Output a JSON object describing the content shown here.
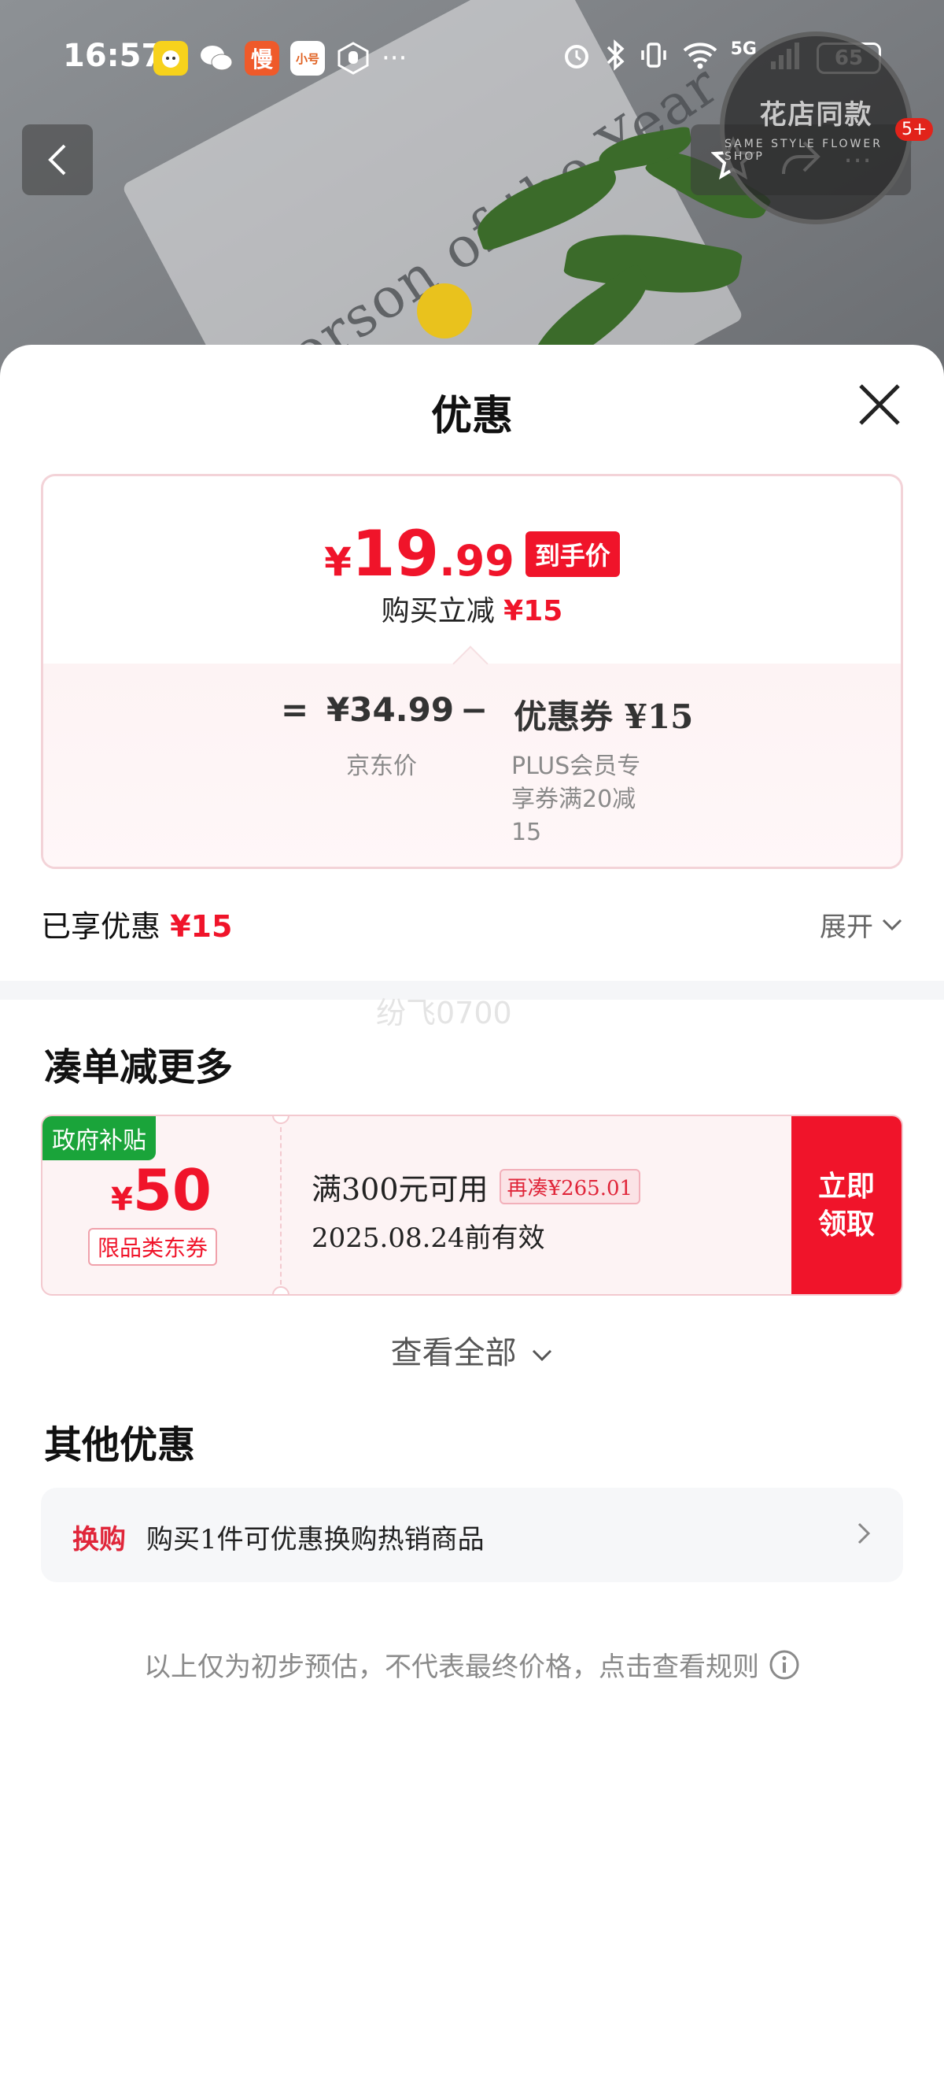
{
  "status_bar": {
    "time": "16:57",
    "network": "5G",
    "battery": "65",
    "app_icons": [
      "kids-app-icon",
      "wechat-icon",
      "man-app-icon",
      "xiaohao-app-icon",
      "hand-icon"
    ],
    "app_labels": {
      "man": "慢",
      "xiaohao": "小号"
    },
    "more": "···"
  },
  "product_bg": {
    "magazine_text": "Person of the Year",
    "stamp_title": "花店同款",
    "stamp_sub": "SAME STYLE FLOWER SHOP",
    "notification_badge": "5+"
  },
  "sheet": {
    "title": "优惠",
    "price_card": {
      "yen": "¥",
      "price_int": "19",
      "price_dec": ".99",
      "price_tag": "到手价",
      "instant_label": "购买立减",
      "instant_amount": "¥15",
      "equals": "=",
      "jd_price": "¥34.99",
      "minus": "−",
      "coupon_label": "优惠券 ¥15",
      "jd_price_caption": "京东价",
      "coupon_caption_lines": [
        "PLUS会员专",
        "享券满20减",
        "15"
      ]
    },
    "enjoyed": {
      "label": "已享优惠",
      "amount": "¥15",
      "expand": "展开"
    },
    "watermark": "纷飞0700",
    "combine_section": {
      "title": "凑单减更多",
      "coupon": {
        "gov_tag": "政府补贴",
        "yen": "¥",
        "amount": "50",
        "category": "限品类东券",
        "condition": "满300元可用",
        "need_more": "再凑¥265.01",
        "valid_until": "2025.08.24前有效",
        "claim_line1": "立即",
        "claim_line2": "领取"
      },
      "see_all": "查看全部"
    },
    "other_section": {
      "title": "其他优惠",
      "swap_tag": "换购",
      "swap_text": "购买1件可优惠换购热销商品"
    },
    "disclaimer": "以上仅为初步预估，不代表最终价格，点击查看规则"
  },
  "colors": {
    "accent_red": "#f0142a",
    "gov_green": "#1aa43a",
    "card_border": "#f3d3d8",
    "muted_text": "#8a8a8a"
  }
}
